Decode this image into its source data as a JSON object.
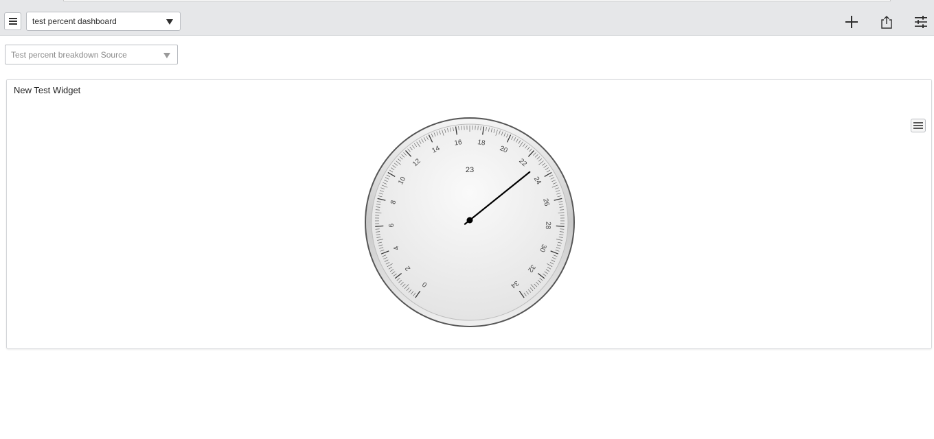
{
  "toolbar": {
    "dashboard_select_value": "test percent dashboard",
    "menu_icon": "hamburger-icon",
    "add_icon": "plus-icon",
    "share_icon": "share-icon",
    "filters_icon": "sliders-icon"
  },
  "filter": {
    "placeholder": "Test percent breakdown Source"
  },
  "widget": {
    "title": "New Test Widget",
    "menu_icon": "hamburger-icon",
    "gauge": {
      "value_label": "23"
    }
  },
  "chart_data": {
    "type": "gauge",
    "min": 0,
    "max": 34,
    "value": 23,
    "tick_labels": [
      "0",
      "2",
      "4",
      "6",
      "8",
      "10",
      "12",
      "14",
      "16",
      "18",
      "20",
      "22",
      "24",
      "26",
      "28",
      "30",
      "32",
      "34"
    ],
    "colors": {
      "needle": "#000000",
      "face": "#f2f2f2",
      "rim": "#555555"
    }
  }
}
